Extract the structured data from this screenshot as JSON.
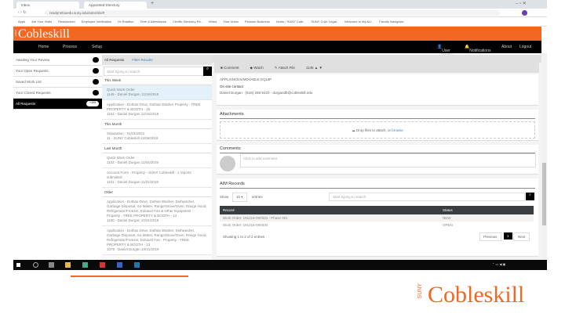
{
  "browser": {
    "tabs": [
      "Inbox",
      "Appointed Directory"
    ],
    "url": "readynetsuedu.suny.edu/aims/sls/#",
    "bookmarks": [
      "Apps",
      "Are Your Visits",
      "Researched",
      "Employee Verification",
      "Hr Rotation",
      "Time & Attendance",
      "Certific Directory Re..",
      "Wires",
      "Your Union",
      "Pension Business",
      "Home / SUNY Cobl..",
      "SUNY Cobl. Legal..",
      "Welcome to My AU..",
      "Faculty Navigator.."
    ]
  },
  "header": {
    "logo": "Cobleskill",
    "logo_small": "SUNY"
  },
  "nav": {
    "left": [
      "Home",
      "Process",
      "Setup"
    ],
    "right": [
      "User Profile",
      "Notifications",
      "About",
      "Logout"
    ]
  },
  "sidebar": [
    {
      "label": "Awaiting Your Review",
      "count": "0"
    },
    {
      "label": "Your Open Requests",
      "count": "1"
    },
    {
      "label": "Saved Work List",
      "count": "1"
    },
    {
      "label": "Your Closed Requests",
      "count": "0"
    },
    {
      "label": "All Requests",
      "count": "+100"
    }
  ],
  "list": {
    "tabs": [
      "All Requests",
      "Filter Results"
    ],
    "search_placeholder": "Start typing to search",
    "groups": [
      {
        "title": "This Week",
        "items": [
          {
            "title": "Quick Work Order",
            "sub": "1145 - Daniel Durgan 12/19/2019"
          },
          {
            "title": "Application - Dothas Drive, Dothas Washer Property - TREE",
            "sub": "PROPERTY & BOOTH - 15",
            "sub2": "1104 - Daniel Durgan 12/16/2019"
          }
        ]
      },
      {
        "title": "This Month",
        "items": [
          {
            "title": "Separation - 01/21/2021",
            "sub": "11 - SUNY Cobleskill 12/06/2019"
          }
        ]
      },
      {
        "title": "Last Month",
        "items": [
          {
            "title": "Quick Work Order",
            "sub": "1102 - Daniel Durgan 11/04/2019"
          },
          {
            "title": "Account Form - Property - SUNY Cobleskill - 1 reports",
            "sub": "submitted",
            "sub2": "1101 - Daniel Durgan 11/01/2019"
          }
        ]
      },
      {
        "title": "Older",
        "items": [
          {
            "title": "Application - Dothas Drive, Dothas Washer, Dishwasher,",
            "sub": "Garbage Disposal, Ice Maker, Range/Stove/Oven, Range Hood,",
            "sub2": "Refrigerator/Freezer, Exhaust Fan & Other Equipment - Property - TREE PROPERTY & BOOTH - 14",
            "sub3": "1100 - Daniel Durgan 10/31/2019"
          },
          {
            "title": "Application - Dothas Drive, Dothas Washer, Dishwasher,",
            "sub": "Garbage Disposal, Ice Maker, Range/Stove/Oven, Range Hood,",
            "sub2": "Refrigerator/Freezer, Exhaust Fan - Property - TREE PROPERTY & BOOTH - 13",
            "sub3": "1079 - Daniel Durgan 10/31/2019"
          }
        ]
      }
    ]
  },
  "main": {
    "toolbar": [
      "Comment",
      "Watch",
      "Attach File",
      "1145"
    ],
    "detail_value": "APPLIANCES/MOVABLE EQUIP",
    "contact_label": "On site contact",
    "contact_value": "Daniel Durgan - (518) 255-5420 - durgandb@cobleskill.edu",
    "attachments": {
      "title": "Attachments",
      "drop": "Drop files to attach, or",
      "browse": "browse"
    },
    "comments": {
      "title": "Comments",
      "placeholder": "Click to add comment"
    },
    "aim": {
      "title": "AIM Records",
      "show": "Show",
      "entries_value": "10",
      "entries": "entries",
      "search_placeholder": "Start typing to search",
      "columns": [
        "Record",
        "Status"
      ],
      "rows": [
        [
          "Work Order: 191216-000331 - Phase 001",
          "NEW"
        ],
        [
          "Work Order: 191216-000334",
          "OPEN"
        ]
      ],
      "info": "Showing 1 to 2 of 2 entries",
      "prev": "Previous",
      "page": "1",
      "next": "Next"
    }
  },
  "footer_logo": {
    "text": "Cobleskill",
    "small": "SUNY"
  },
  "colors": {
    "brand": "#f26722",
    "nav": "#000000"
  }
}
